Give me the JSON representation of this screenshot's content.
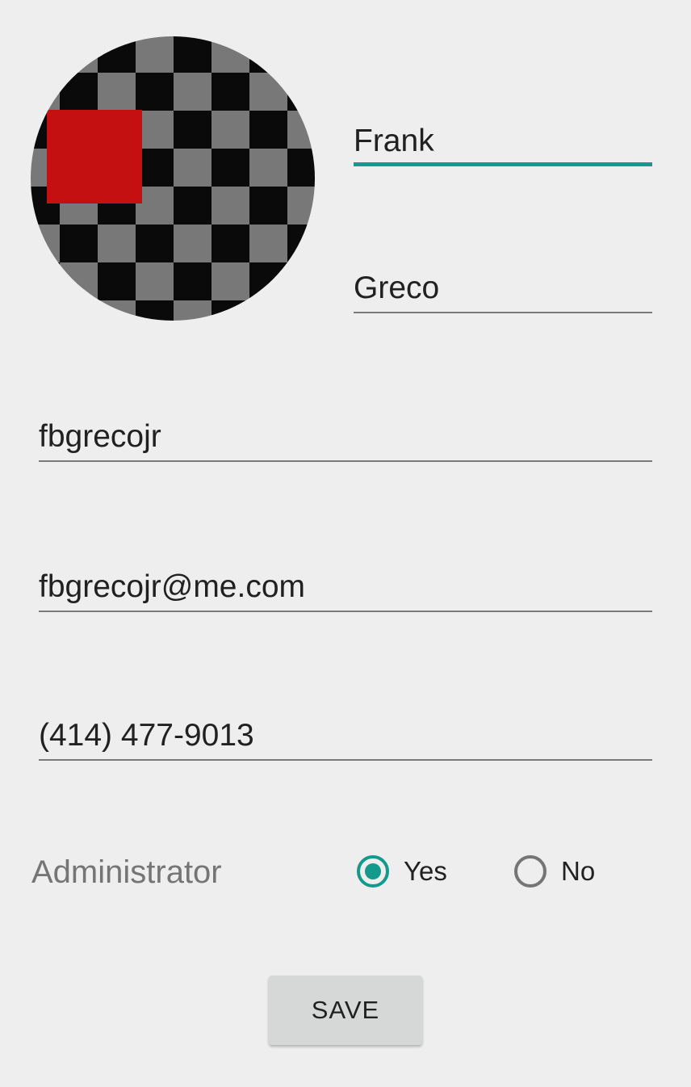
{
  "profile": {
    "avatar_icon": "checkerboard-avatar-image",
    "first_name": "Frank",
    "last_name": "Greco",
    "username": "fbgrecojr",
    "email": "fbgrecojr@me.com",
    "phone": "(414) 477-9013"
  },
  "admin": {
    "label": "Administrator",
    "options": [
      {
        "label": "Yes",
        "checked": true
      },
      {
        "label": "No",
        "checked": false
      }
    ]
  },
  "actions": {
    "save_label": "SAVE"
  },
  "colors": {
    "accent": "#139a8c",
    "background": "#eeeeee",
    "avatar_red": "#c41010"
  }
}
